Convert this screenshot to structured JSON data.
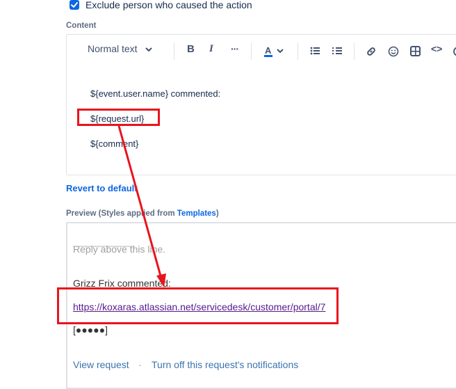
{
  "options": {
    "exclude_label": "Exclude person who caused the action",
    "exclude_checked": true
  },
  "content": {
    "label": "Content",
    "toolbar": {
      "text_style": "Normal text",
      "bold": "B",
      "italic": "I",
      "more": "···",
      "code": "<>"
    },
    "lines": [
      "${event.user.name} commented:",
      "${request.url}",
      "${comment}"
    ]
  },
  "revert_label": "Revert to default",
  "preview_label": {
    "prefix": "Preview (Styles applied from ",
    "link": "Templates",
    "suffix": ")"
  },
  "preview": {
    "underline": "______________",
    "reply": "Reply above this line.",
    "commented": "Grizz Frix commented:",
    "url": "https://koxaras.atlassian.net/servicedesk/customer/portal/7",
    "comment": "[●●●●●]",
    "view_request": "View request",
    "separator": "·",
    "turn_off": "Turn off this request's notifications"
  },
  "colors": {
    "accent": "#0c66e4",
    "annotation": "#e8141d",
    "visited_link": "#551a8b",
    "preview_link": "#3b73af"
  },
  "icons": [
    "check-icon",
    "chevron-down-icon",
    "text-color-icon",
    "bullet-list-icon",
    "numbered-list-icon",
    "link-icon",
    "emoji-icon",
    "table-icon",
    "code-icon"
  ]
}
